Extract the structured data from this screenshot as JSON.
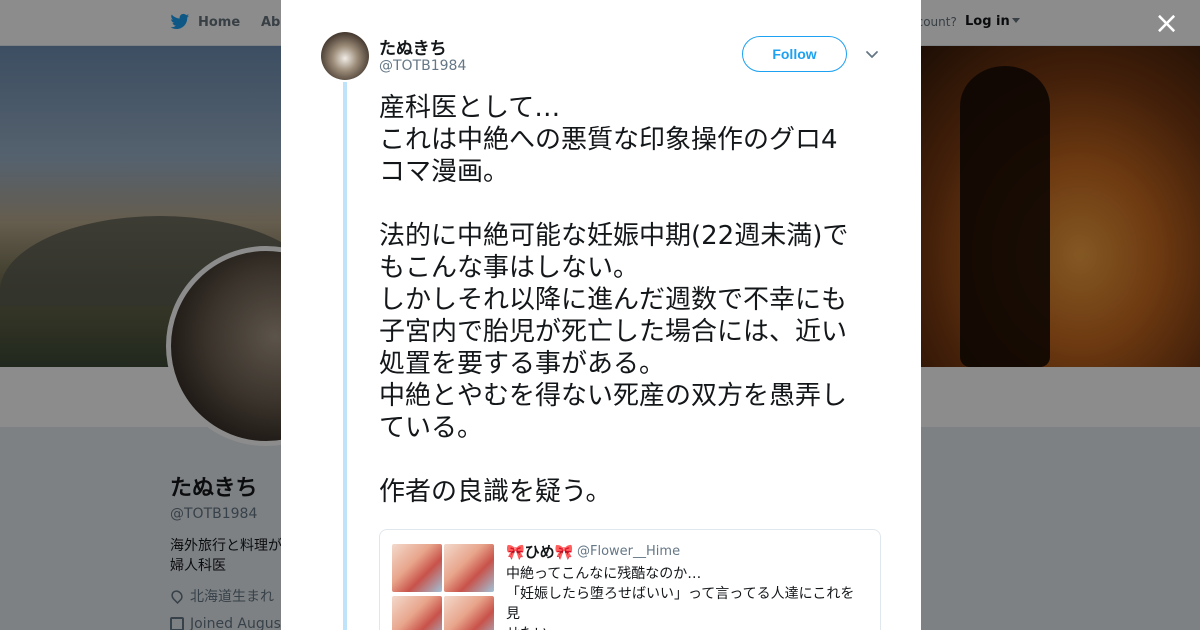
{
  "nav": {
    "home_label": "Home",
    "about_label": "Abo",
    "account_prompt": "ccount?",
    "login_label": "Log in"
  },
  "profile": {
    "name": "たぬきち",
    "handle": "@TOTB1984",
    "bio": "海外旅行と料理が\n婦人科医",
    "location": "北海道生まれ",
    "joined": "Joined August"
  },
  "modal": {
    "close_icon": "×",
    "author_name": "たぬきち",
    "author_handle": "@TOTB1984",
    "follow_label": "Follow",
    "tweet_text": "産科医として…\nこれは中絶への悪質な印象操作のグロ4\nコマ漫画。\n\n法的に中絶可能な妊娠中期(22週未満)で\nもこんな事はしない。\nしかしそれ以降に進んだ週数で不幸にも\n子宮内で胎児が死亡した場合には、近い\n処置を要する事がある。\n中絶とやむを得ない死産の双方を愚弄し\nている。\n\n作者の良識を疑う。",
    "quote": {
      "name": "🎀ひめ🎀",
      "handle": "@Flower__Hime",
      "text": "中絶ってこんなに残酷なのか…\n「妊娠したら堕ろせばいい」って言ってる人達にこれを見\nせたい。"
    }
  },
  "colors": {
    "accent": "#1da1f2",
    "thread_line": "#bfe3fa",
    "muted_text": "#657786"
  }
}
